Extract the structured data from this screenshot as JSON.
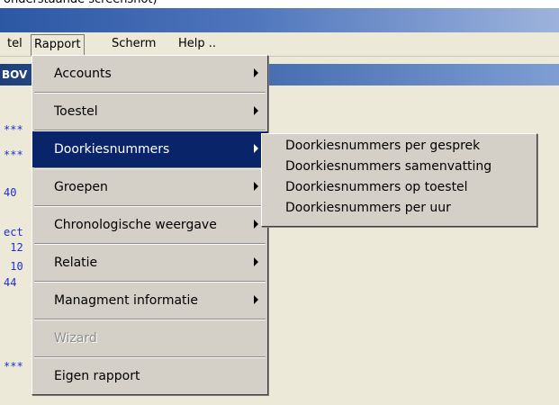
{
  "caption": "onderstaande screenshot)",
  "menubar": {
    "items": [
      {
        "label": "tel"
      },
      {
        "label": "Rapport"
      },
      {
        "label": "Scherm"
      },
      {
        "label": "Help .."
      }
    ]
  },
  "child_window": {
    "title_fragment": "BOV"
  },
  "document_lines": [
    "***",
    "***",
    "40",
    "ect",
    " 12",
    " 10",
    "44",
    "***"
  ],
  "rapport_menu": {
    "items": [
      {
        "label": "Accounts"
      },
      {
        "label": "Toestel"
      },
      {
        "label": "Doorkiesnummers"
      },
      {
        "label": "Groepen"
      },
      {
        "label": "Chronologische weergave"
      },
      {
        "label": "Relatie"
      },
      {
        "label": "Managment informatie"
      },
      {
        "label": "Wizard"
      },
      {
        "label": "Eigen rapport"
      }
    ]
  },
  "doorkies_submenu": {
    "items": [
      {
        "label": "Doorkiesnummers per gesprek"
      },
      {
        "label": "Doorkiesnummers samenvatting"
      },
      {
        "label": "Doorkiesnummers op toestel"
      },
      {
        "label": "Doorkiesnummers per uur"
      }
    ]
  },
  "colors": {
    "selection": "#0a246a",
    "menu_bg": "#d4d0c8",
    "text_blue": "#1e2fd0"
  }
}
